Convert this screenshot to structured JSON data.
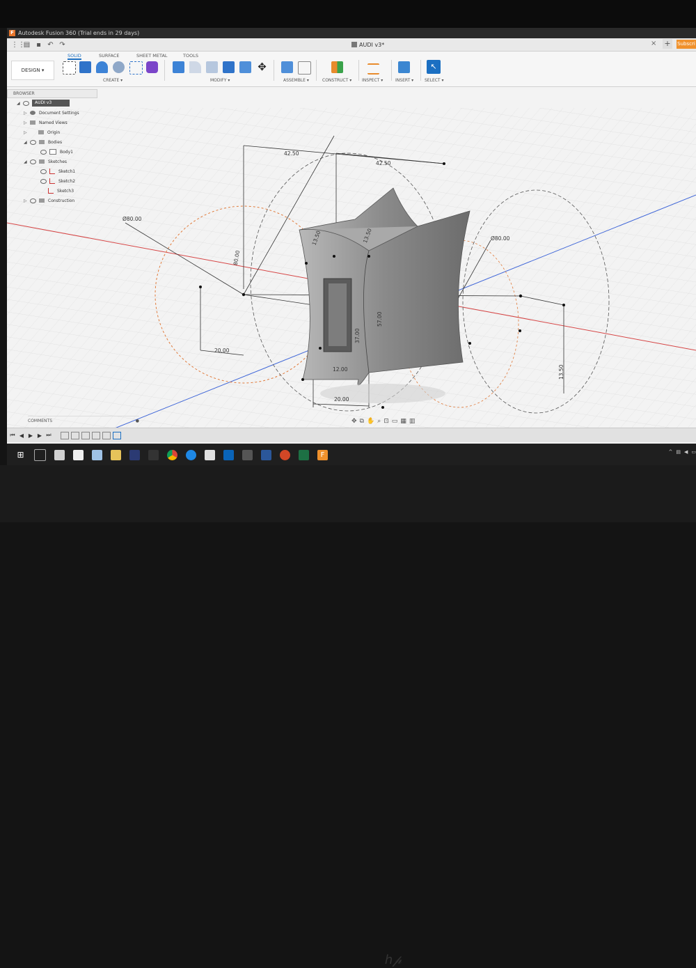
{
  "window": {
    "title": "Autodesk Fusion 360 (Trial ends in 29 days)"
  },
  "document": {
    "tab_title": "AUDI v3*"
  },
  "actions": {
    "close": "×",
    "new_tab": "+",
    "subscribe": "Subscri"
  },
  "workspace": {
    "label": "DESIGN ▾"
  },
  "ribbon": {
    "tabs": [
      "SOLID",
      "SURFACE",
      "SHEET METAL",
      "TOOLS"
    ],
    "groups": [
      "CREATE ▾",
      "MODIFY ▾",
      "ASSEMBLE ▾",
      "CONSTRUCT ▾",
      "INSPECT ▾",
      "INSERT ▾",
      "SELECT ▾"
    ]
  },
  "browser": {
    "title": "BROWSER",
    "root": "AUDI v3",
    "items": [
      {
        "label": "Document Settings"
      },
      {
        "label": "Named Views"
      },
      {
        "label": "Origin"
      },
      {
        "label": "Bodies"
      },
      {
        "label": "Body1"
      },
      {
        "label": "Sketches"
      },
      {
        "label": "Sketch1"
      },
      {
        "label": "Sketch2"
      },
      {
        "label": "Sketch3"
      },
      {
        "label": "Construction"
      }
    ]
  },
  "dimensions": [
    "42.50",
    "42.50",
    "Ø80.00",
    "Ø80.00",
    "80.00",
    "13.50",
    "13.50",
    "57.00",
    "37.00",
    "12.00",
    "20.00",
    "20.00",
    "13.50"
  ],
  "comments": {
    "label": "COMMENTS"
  },
  "colors": {
    "accent": "#1b6fc2",
    "model": "#8d8d8d",
    "construction": "#e07a3a",
    "axis_red": "#d64545",
    "axis_blue": "#3f66d8"
  }
}
